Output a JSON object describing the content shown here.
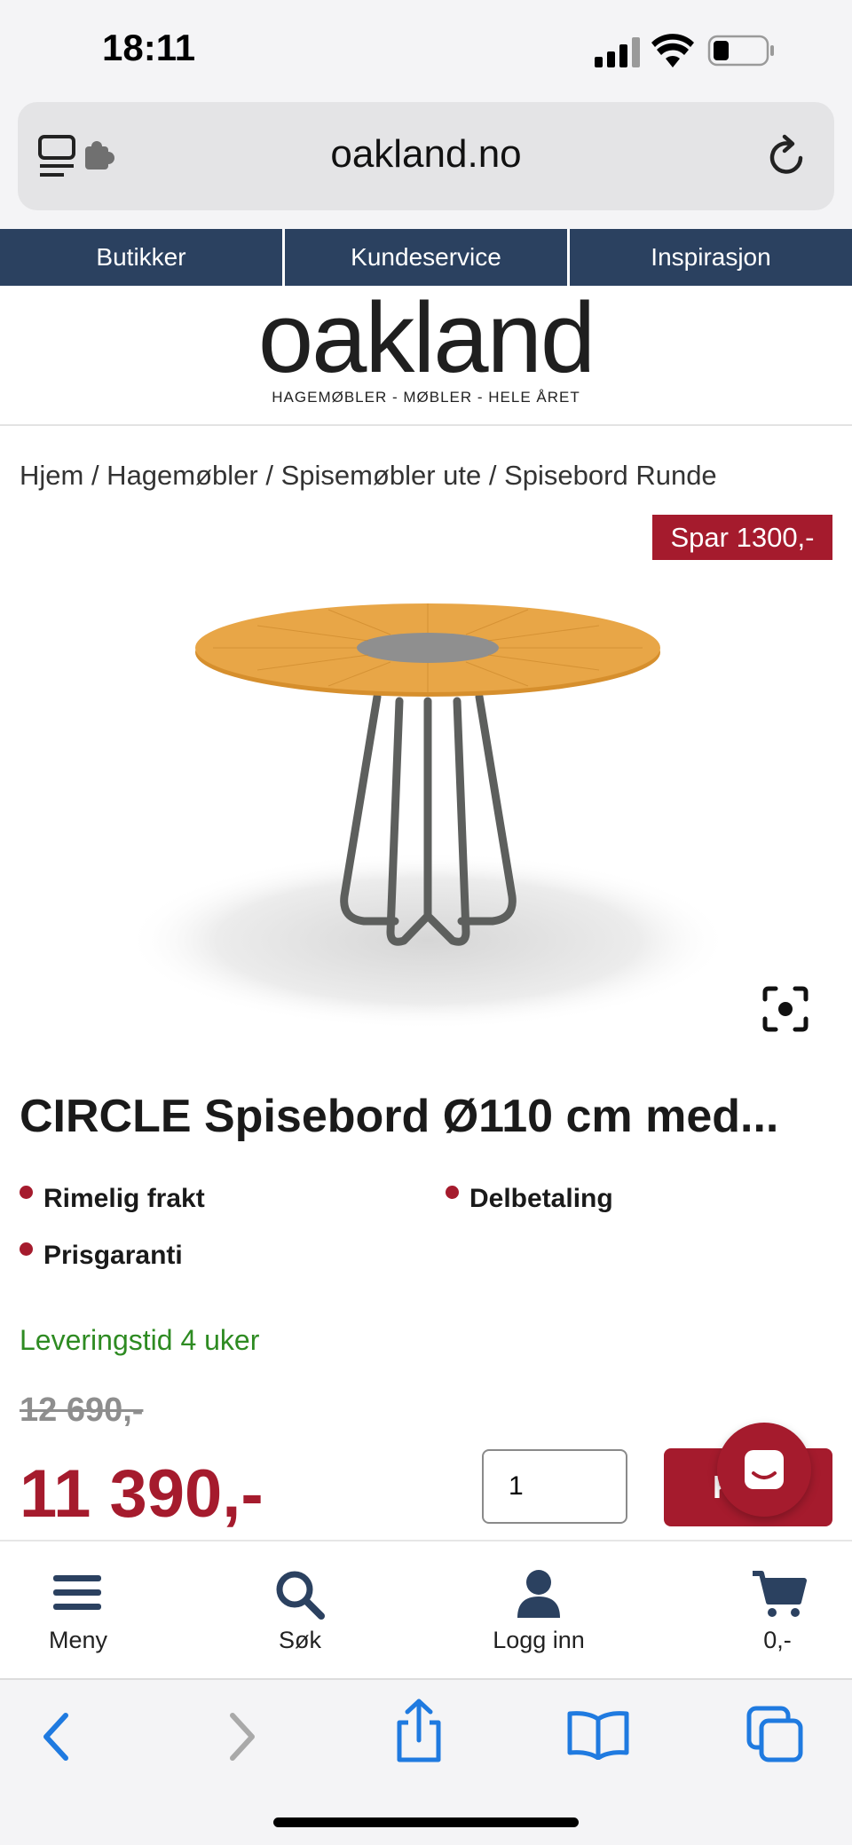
{
  "status_bar": {
    "time": "18:11"
  },
  "browser": {
    "url": "oakland.no"
  },
  "top_nav": {
    "items": [
      "Butikker",
      "Kundeservice",
      "Inspirasjon"
    ]
  },
  "brand": {
    "logo_text": "oakland",
    "tagline": "HAGEMØBLER - MØBLER - HELE ÅRET"
  },
  "breadcrumb": {
    "text": "Hjem / Hagemøbler / Spisemøbler ute / Spisebord Runde"
  },
  "product": {
    "badge": "Spar 1300,-",
    "title": "CIRCLE Spisebord Ø110 cm med...",
    "usps": [
      "Rimelig frakt",
      "Delbetaling",
      "Prisgaranti"
    ],
    "delivery": "Leveringstid 4 uker",
    "old_price": "12 690,-",
    "price": "11 390,-",
    "quantity": "1",
    "buy_label": "Kjøp"
  },
  "site_nav": {
    "items": [
      "Meny",
      "Søk",
      "Logg inn",
      "0,-"
    ]
  },
  "colors": {
    "brand_navy": "#2b4160",
    "accent_red": "#a51b2d",
    "success_green": "#2e8b22",
    "ios_blue": "#1f7ae0"
  },
  "icons": [
    "reader-icon",
    "extension-icon",
    "reload-icon",
    "fullscreen-icon",
    "chat-icon",
    "menu-icon",
    "search-icon",
    "user-icon",
    "cart-icon",
    "back-icon",
    "forward-icon",
    "share-icon",
    "bookmarks-icon",
    "tabs-icon"
  ]
}
